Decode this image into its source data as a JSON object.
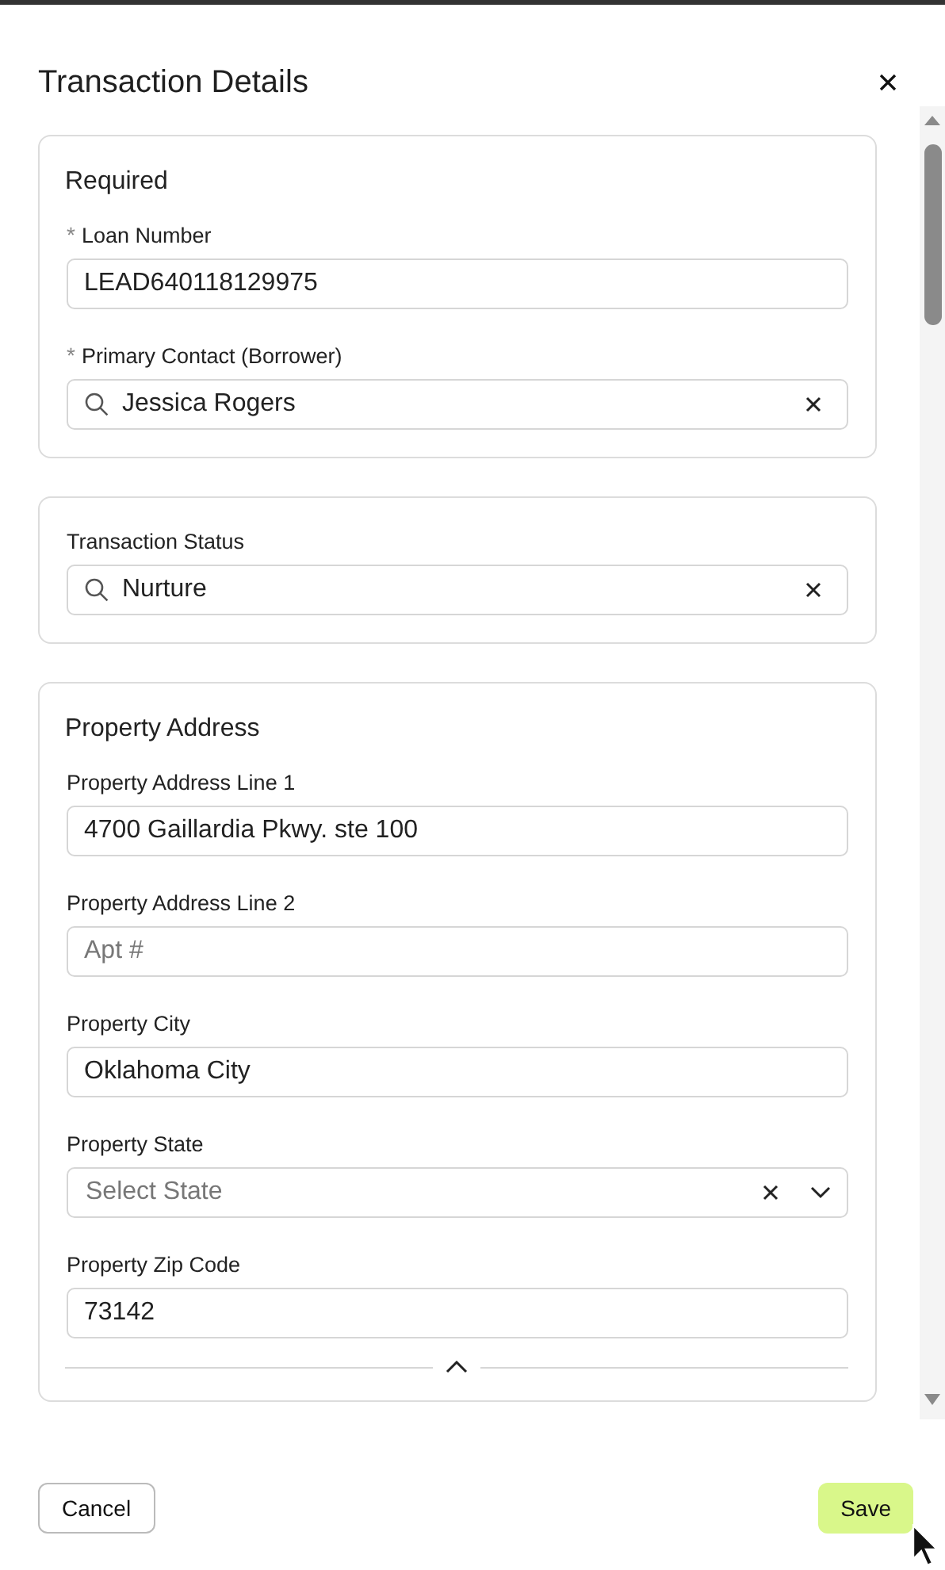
{
  "title": "Transaction Details",
  "sections": [
    {
      "heading": "Required",
      "fields": [
        {
          "label": "Loan Number",
          "marker": "*",
          "kind": "text",
          "value": "LEAD640118129975"
        },
        {
          "label": "Primary Contact (Borrower)",
          "marker": "*",
          "kind": "search",
          "value": "Jessica Rogers"
        }
      ]
    },
    {
      "fields": [
        {
          "label": "Transaction Status",
          "kind": "search",
          "value": "Nurture"
        }
      ]
    },
    {
      "heading": "Property Address",
      "collapsible": true,
      "fields": [
        {
          "label": "Property Address Line 1",
          "kind": "text",
          "value": "4700 Gaillardia Pkwy. ste 100"
        },
        {
          "label": "Property Address Line 2",
          "kind": "text",
          "placeholder": "Apt #"
        },
        {
          "label": "Property City",
          "kind": "text",
          "value": "Oklahoma City"
        },
        {
          "label": "Property State",
          "kind": "select",
          "placeholder": "Select State"
        },
        {
          "label": "Property Zip Code",
          "kind": "text",
          "value": "73142"
        }
      ]
    }
  ],
  "buttons": {
    "cancel": "Cancel",
    "save": "Save"
  }
}
